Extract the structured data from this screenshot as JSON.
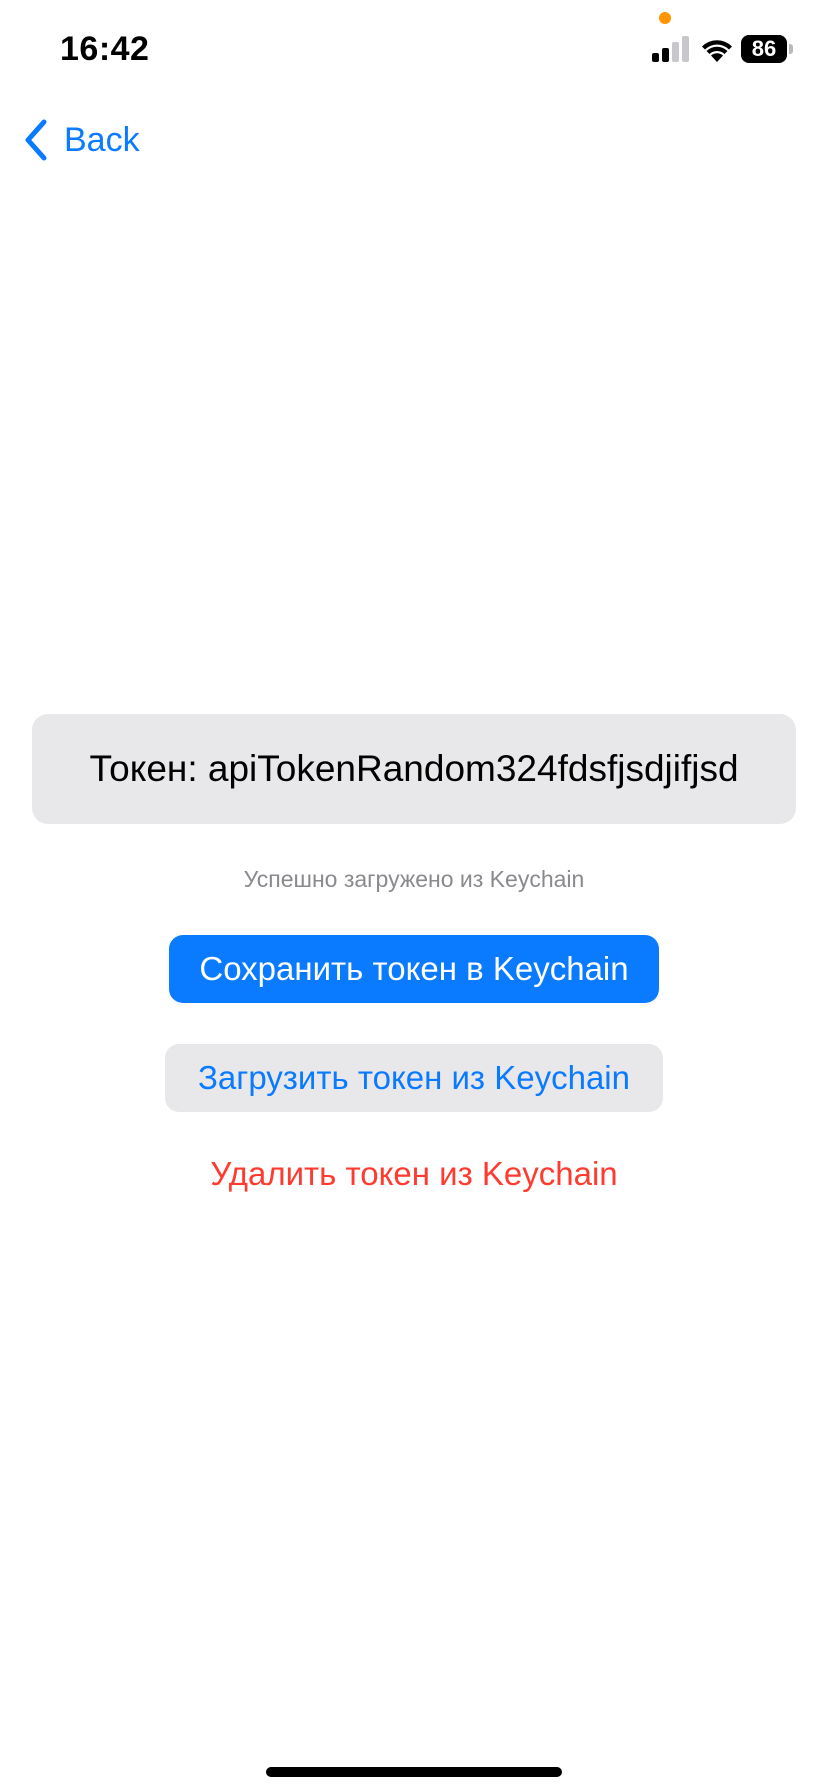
{
  "status_bar": {
    "time": "16:42",
    "battery_level": "86",
    "icons": [
      "signal-icon",
      "wifi-icon",
      "battery-icon"
    ],
    "privacy_dot_color": "#ff9500"
  },
  "nav": {
    "back_label": "Back",
    "icon": "chevron-left-icon"
  },
  "token": {
    "text": "Токен: apiTokenRandom324fdsfjsdjifjsd"
  },
  "status_message": "Успешно загружено из Keychain",
  "buttons": {
    "save": "Сохранить токен в Keychain",
    "load": "Загрузить токен из Keychain",
    "delete": "Удалить токен из Keychain"
  },
  "colors": {
    "accent": "#0a7aff",
    "destructive": "#ff3b30",
    "secondary_fill": "#e8e8ea",
    "secondary_text": "#8a8a8e"
  }
}
